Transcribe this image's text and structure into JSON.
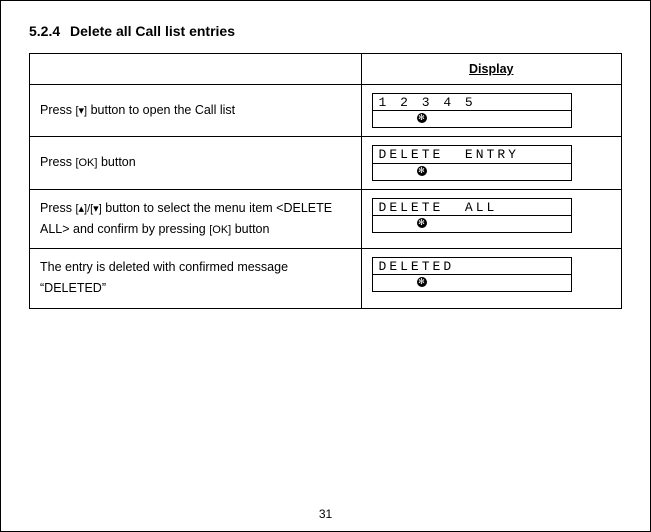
{
  "heading": {
    "number": "5.2.4",
    "title": "Delete all Call list entries"
  },
  "table": {
    "display_header": "Display",
    "rows": [
      {
        "instr_pre": "Press ",
        "btn1": "[▾]",
        "instr_mid": " button to open the Call list",
        "btn2": "",
        "instr_post": "",
        "lcd_line1": "1 2 3 4 5"
      },
      {
        "instr_pre": "Press ",
        "btn1": "[OK]",
        "instr_mid": " button",
        "btn2": "",
        "instr_post": "",
        "lcd_line1": "DELETE  ENTRY"
      },
      {
        "instr_pre": "Press ",
        "btn1": "[▴]/[▾]",
        "instr_mid": " button to select the menu item <DELETE ALL> and confirm by pressing   ",
        "btn2": "[OK]",
        "instr_post": " button",
        "lcd_line1": "DELETE  ALL"
      },
      {
        "instr_pre": "The entry is deleted  with confirmed message “DELETED”",
        "btn1": "",
        "instr_mid": "",
        "btn2": "",
        "instr_post": "",
        "lcd_line1": "DELETED"
      }
    ]
  },
  "page_number": "31",
  "bt_glyph": "✻"
}
